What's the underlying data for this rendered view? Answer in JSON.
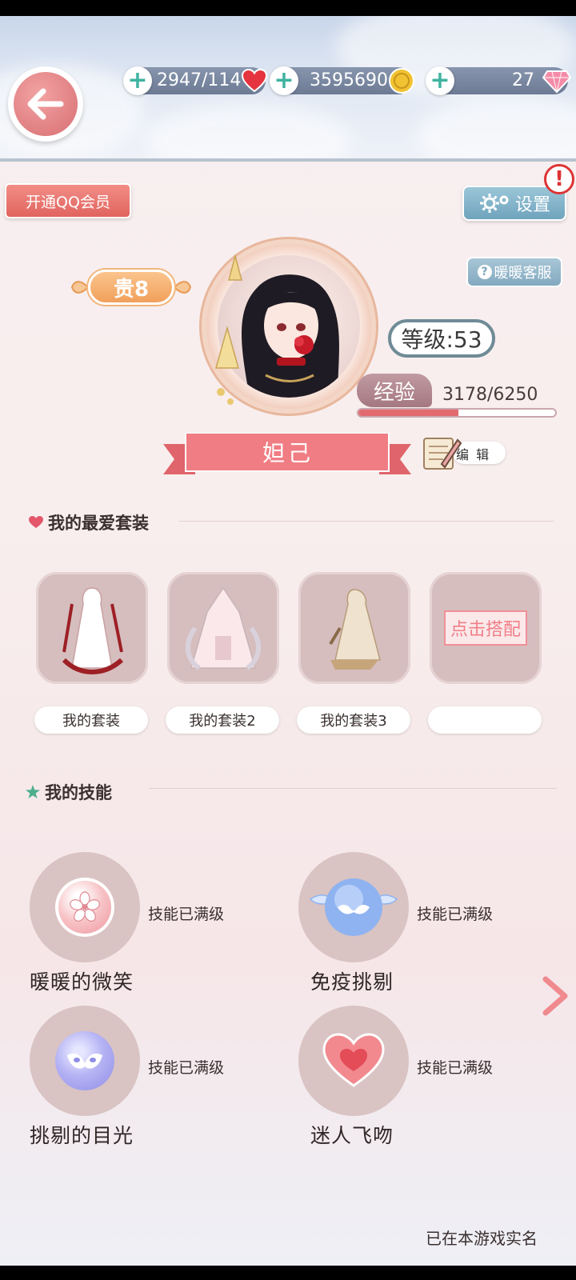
{
  "resources": {
    "stamina": "2947/114",
    "coins": "3595690",
    "diamonds": "27"
  },
  "header": {
    "qq_member_button": "开通QQ会员",
    "settings_button": "设置",
    "service_button": "暖暖客服"
  },
  "profile": {
    "vip_label": "贵8",
    "level_label": "等级:53",
    "exp_label": "经验",
    "exp_value": "3178/6250",
    "exp_progress": 0.5085,
    "name": "妲己",
    "edit_label": "编 辑"
  },
  "favorites": {
    "title": "我的最爱套装",
    "outfits": [
      {
        "name": "我的套装"
      },
      {
        "name": "我的套装2"
      },
      {
        "name": "我的套装3"
      },
      {
        "name": ""
      }
    ],
    "match_button": "点击搭配"
  },
  "skills": {
    "title": "我的技能",
    "items": [
      {
        "name": "暖暖的微笑",
        "state": "技能已满级",
        "icon": "sakura-icon",
        "color": "#f2a7ad"
      },
      {
        "name": "免疫挑剔",
        "state": "技能已满级",
        "icon": "winged-mask-icon",
        "color": "#8fb3f0"
      },
      {
        "name": "挑剔的目光",
        "state": "技能已满级",
        "icon": "mask-icon",
        "color": "#a7a6ef"
      },
      {
        "name": "迷人飞吻",
        "state": "技能已满级",
        "icon": "heart-icon",
        "color": "#f2898f"
      }
    ]
  },
  "footer": {
    "realname_text": "已在本游戏实名"
  },
  "colors": {
    "accent_red": "#e26b70",
    "teal_plus": "#3fb3a0",
    "card_bg": "#d6bebf"
  }
}
